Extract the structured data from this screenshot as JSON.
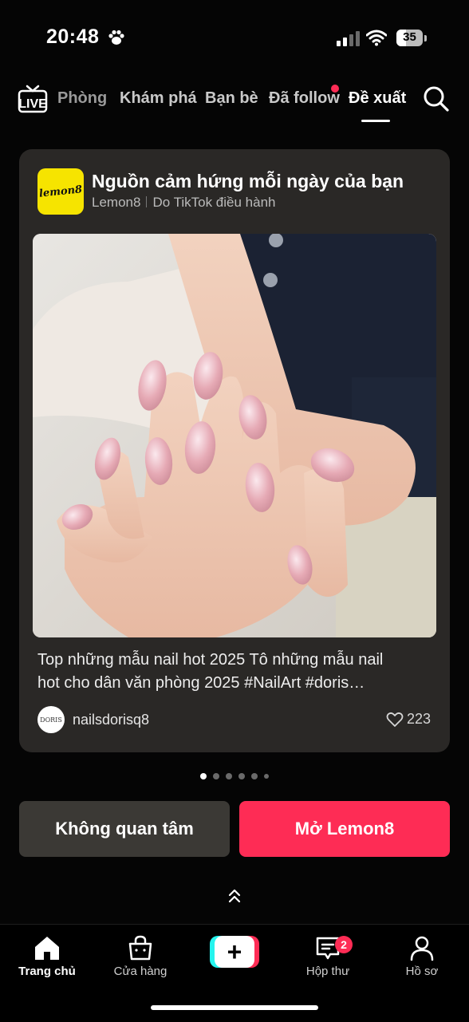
{
  "status_bar": {
    "time": "20:48",
    "battery": "35",
    "battery_level": 0.35,
    "icons": [
      "paw-icon",
      "cellular-signal-icon",
      "wifi-icon",
      "battery-icon"
    ]
  },
  "top_nav": {
    "live_label": "LIVE",
    "tabs": [
      {
        "label": "Phòng"
      },
      {
        "label": "Khám phá"
      },
      {
        "label": "Bạn bè"
      },
      {
        "label": "Đã follow"
      },
      {
        "label": "Đề xuất",
        "active": true
      }
    ],
    "icons": [
      "live-icon",
      "search-icon"
    ]
  },
  "card": {
    "app_logo_text": "lemon8",
    "title": "Nguồn cảm hứng mỗi ngày của bạn",
    "brand": "Lemon8",
    "operator": "Do TikTok điều hành",
    "description_line1": "Top những mẫu nail hot 2025 Tô những mẫu nail",
    "description_line2": "hot cho dân văn phòng 2025  #NailArt  #doris…",
    "avatar_text": "DORIS",
    "author": "nailsdorisq8",
    "likes": "223"
  },
  "carousel": {
    "total": 6,
    "current": 1
  },
  "actions": {
    "not_interested": "Không quan tâm",
    "open": "Mở Lemon8"
  },
  "bottom_nav": {
    "items": [
      {
        "label": "Trang chủ",
        "icon": "home-icon",
        "active": true
      },
      {
        "label": "Cửa hàng",
        "icon": "shop-bag-icon"
      },
      {
        "label": "",
        "icon": "create-plus-icon"
      },
      {
        "label": "Hộp thư",
        "icon": "inbox-icon",
        "badge": "2"
      },
      {
        "label": "Hồ sơ",
        "icon": "profile-icon"
      }
    ]
  },
  "colors": {
    "accent": "#fe2c55",
    "background": "#050505",
    "card": "#2a2826",
    "lemon8_yellow": "#f6e400",
    "create_cyan": "#25f4ee"
  }
}
